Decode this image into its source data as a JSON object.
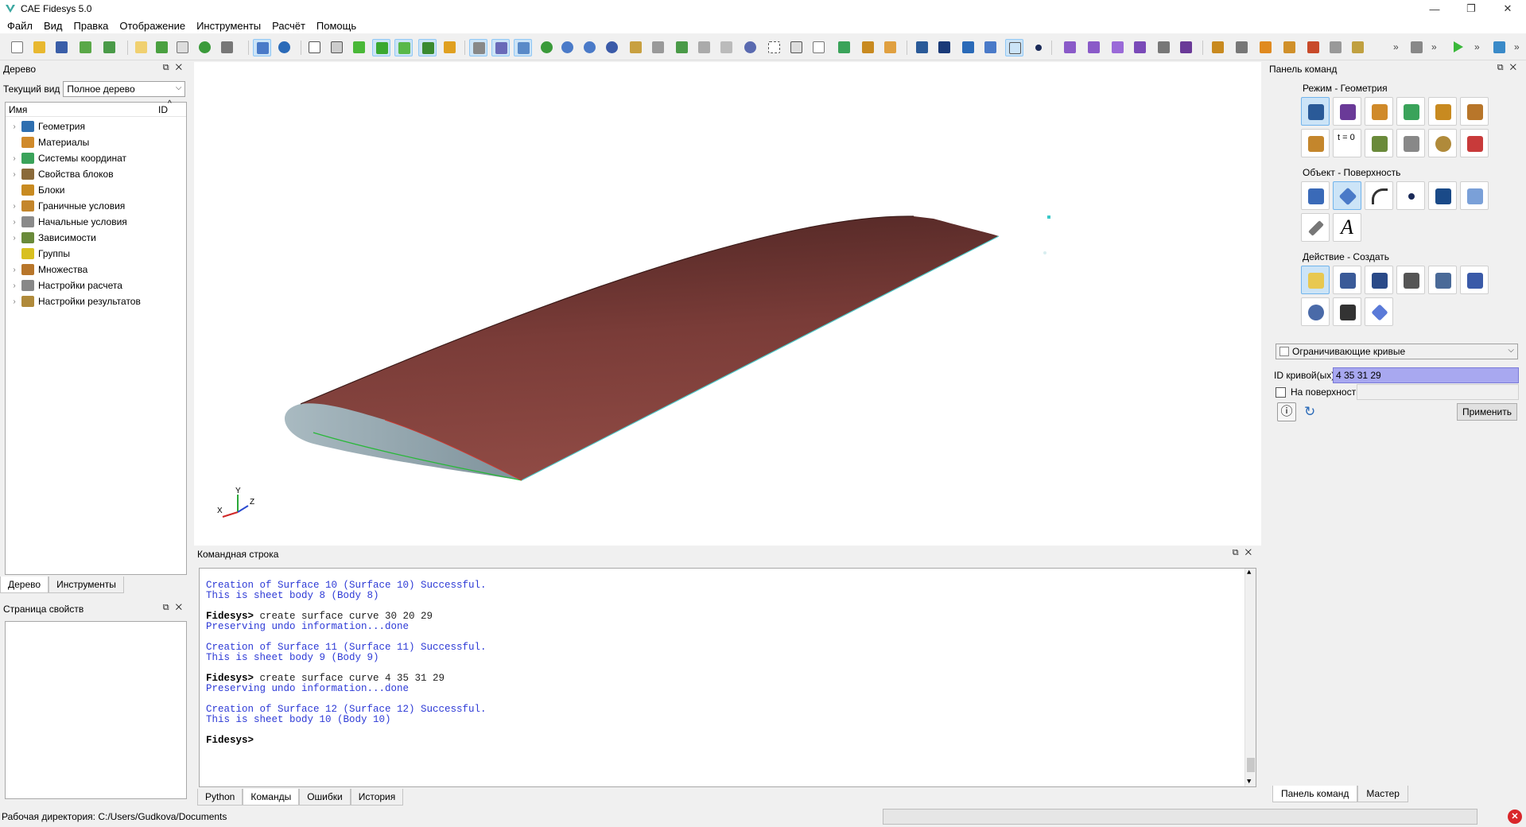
{
  "window": {
    "title": "CAE Fidesys 5.0",
    "controls": [
      "—",
      "❐",
      "✕"
    ]
  },
  "menu": [
    "Файл",
    "Вид",
    "Правка",
    "Отображение",
    "Инструменты",
    "Расчёт",
    "Помощь"
  ],
  "toolbar": {
    "overflow": "»"
  },
  "tree_panel": {
    "title": "Дерево",
    "current_view_label": "Текущий вид",
    "current_view_value": "Полное дерево",
    "col_name": "Имя",
    "col_id": "ID",
    "items": [
      {
        "label": "Геометрия",
        "icon": "geometry-icon",
        "color": "#2f6fb0",
        "expandable": true
      },
      {
        "label": "Материалы",
        "icon": "materials-icon",
        "color": "#d08a2a",
        "expandable": false
      },
      {
        "label": "Системы координат",
        "icon": "coordinate-systems-icon",
        "color": "#3aa35a",
        "expandable": true
      },
      {
        "label": "Свойства блоков",
        "icon": "block-properties-icon",
        "color": "#8a6a3a",
        "expandable": true
      },
      {
        "label": "Блоки",
        "icon": "blocks-icon",
        "color": "#c88a20",
        "expandable": false
      },
      {
        "label": "Граничные условия",
        "icon": "boundary-conditions-icon",
        "color": "#c4862c",
        "expandable": true
      },
      {
        "label": "Начальные условия",
        "icon": "initial-conditions-icon",
        "color": "#8a8a8a",
        "expandable": true
      },
      {
        "label": "Зависимости",
        "icon": "dependencies-icon",
        "color": "#6a8a3a",
        "expandable": true
      },
      {
        "label": "Группы",
        "icon": "groups-icon",
        "color": "#d8c020",
        "expandable": false
      },
      {
        "label": "Множества",
        "icon": "sets-icon",
        "color": "#b8762a",
        "expandable": true
      },
      {
        "label": "Настройки расчета",
        "icon": "calculation-settings-icon",
        "color": "#888888",
        "expandable": true
      },
      {
        "label": "Настройки результатов",
        "icon": "results-settings-icon",
        "color": "#b08a3a",
        "expandable": true
      }
    ],
    "tabs": [
      "Дерево",
      "Инструменты"
    ]
  },
  "props_panel": {
    "title": "Страница свойств"
  },
  "axis_triad": {
    "x": "X",
    "y": "Y",
    "z": "Z"
  },
  "console": {
    "title": "Командная строка",
    "lines": [
      {
        "type": "out",
        "text": "Creation of Surface 10 (Surface 10) Successful."
      },
      {
        "type": "out",
        "text": "This is sheet body 8 (Body 8)"
      },
      {
        "type": "blank",
        "text": ""
      },
      {
        "type": "cmd",
        "prompt": "Fidesys>",
        "text": " create surface curve 30 20 29"
      },
      {
        "type": "out",
        "text": "Preserving undo information...done"
      },
      {
        "type": "blank",
        "text": ""
      },
      {
        "type": "out",
        "text": "Creation of Surface 11 (Surface 11) Successful."
      },
      {
        "type": "out",
        "text": "This is sheet body 9 (Body 9)"
      },
      {
        "type": "blank",
        "text": ""
      },
      {
        "type": "cmd",
        "prompt": "Fidesys>",
        "text": " create surface curve 4 35 31 29"
      },
      {
        "type": "out",
        "text": "Preserving undo information...done"
      },
      {
        "type": "blank",
        "text": ""
      },
      {
        "type": "out",
        "text": "Creation of Surface 12 (Surface 12) Successful."
      },
      {
        "type": "out",
        "text": "This is sheet body 10 (Body 10)"
      },
      {
        "type": "blank",
        "text": ""
      },
      {
        "type": "cmd",
        "prompt": "Fidesys>",
        "text": ""
      }
    ],
    "tabs": [
      "Python",
      "Команды",
      "Ошибки",
      "История"
    ]
  },
  "command_panel": {
    "title": "Панель команд",
    "mode_title": "Режим - Геометрия",
    "object_title": "Объект - Поверхность",
    "action_title": "Действие - Создать",
    "option_dropdown": "Ограничивающие кривые",
    "curve_id_label": "ID кривой(ых)",
    "curve_id_value": "4 35 31 29",
    "on_surface_label": "На поверхности",
    "t0_label": "t = 0",
    "text_tool_label": "A",
    "apply_label": "Применить",
    "tabs": [
      "Панель команд",
      "Мастер"
    ]
  },
  "status": {
    "workdir": "Рабочая директория: C:/Users/Gudkova/Documents"
  },
  "colors": {
    "wing_top": "#8b4640",
    "wing_top_dark": "#5a2a28",
    "wing_root": "#8fa4ad",
    "accent": "#cce4f7",
    "console_text": "#2d3ad6",
    "curve_id_highlight": "#a8a8f0"
  }
}
